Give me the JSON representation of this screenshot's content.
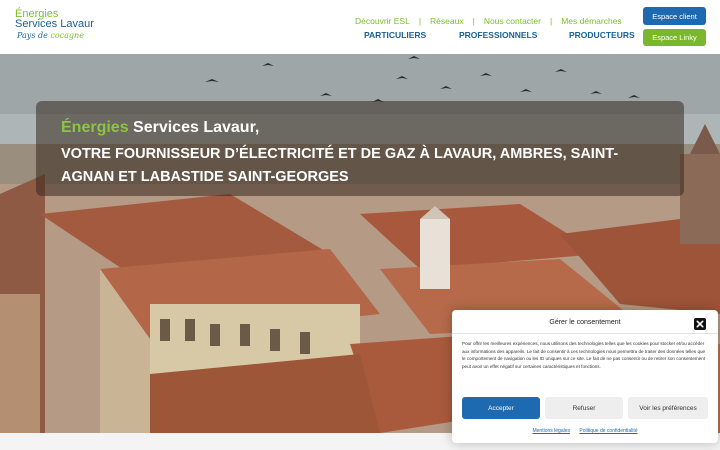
{
  "header": {
    "logo": {
      "line1": "Énergies",
      "line2": "Services Lavaur",
      "tag_part1": "Pays de",
      "tag_part2": "cocagne"
    },
    "top_nav": [
      {
        "label": "Découvrir ESL"
      },
      {
        "label": "Réseaux"
      },
      {
        "label": "Nous contacter"
      },
      {
        "label": "Mes démarches"
      }
    ],
    "main_nav": [
      {
        "label": "PARTICULIERS"
      },
      {
        "label": "PROFESSIONNELS"
      },
      {
        "label": "PRODUCTEURS"
      }
    ],
    "espace_client": "Espace client",
    "espace_linky": "Espace Linky"
  },
  "hero": {
    "title_accent": "Énergies",
    "title_rest": " Services Lavaur,",
    "subtitle": "VOTRE FOURNISSEUR D’ÉLECTRICITÉ ET DE GAZ À LAVAUR, AMBRES, SAINT-AGNAN ET LABASTIDE SAINT-GEORGES"
  },
  "consent": {
    "title": "Gérer le consentement",
    "body": "Pour offrir les meilleures expériences, nous utilisons des technologies telles que les cookies pour stocker et/ou accéder aux informations des appareils. Le fait de consentir à ces technologies nous permettra de traiter des données telles que le comportement de navigation ou les ID uniques sur ce site. Le fait de ne pas consentir ou de retirer son consentement peut avoir un effet négatif sur certaines caractéristiques et fonctions.",
    "accept_label": "Accepter",
    "refuse_label": "Refuser",
    "prefs_label": "Voir les préférences",
    "link_legal": "Mentions légales",
    "link_privacy": "Politique de confidentialité"
  },
  "colors": {
    "brand_blue": "#1e6ab0",
    "brand_green": "#79b82a"
  }
}
